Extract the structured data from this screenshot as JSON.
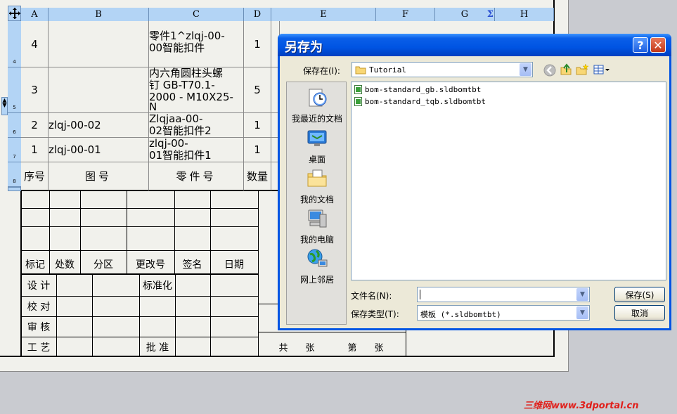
{
  "bom": {
    "columns": [
      "A",
      "B",
      "C",
      "D",
      "E",
      "F",
      "G",
      "H"
    ],
    "rows": [
      {
        "row_no": "4",
        "seq": "4",
        "drawing_no": "",
        "part_name_l1": "零件1^zlqj-00-",
        "part_name_l2": "00智能扣件",
        "qty": "1"
      },
      {
        "row_no": "5",
        "seq": "3",
        "drawing_no": "",
        "part_name_l1": "内六角圆柱头螺",
        "part_name_l2": "钉 GB-T70.1-",
        "part_name_l3": "2000 - M10X25-",
        "part_name_l4": "N",
        "qty": "5"
      },
      {
        "row_no": "6",
        "seq": "2",
        "drawing_no": "zlqj-00-02",
        "part_name_l1": "Zlqjaa-00-",
        "part_name_l2": "02智能扣件2",
        "qty": "1"
      },
      {
        "row_no": "7",
        "seq": "1",
        "drawing_no": "zlqj-00-01",
        "part_name_l1": "zlqj-00-",
        "part_name_l2": "01智能扣件1",
        "qty": "1"
      }
    ],
    "header_row": {
      "row_no": "8",
      "seq": "序号",
      "drawing_no": "图号",
      "part_name": "零件号",
      "qty": "数量"
    }
  },
  "title_block": {
    "revision_labels": [
      "标记",
      "处数",
      "分区",
      "更改号",
      "签名",
      "日期"
    ],
    "design": "设 计",
    "check": "校 对",
    "review": "审 核",
    "process": "工 艺",
    "standardize": "标准化",
    "approve": "批 准",
    "total": "共",
    "sheets": "张",
    "sheet_no": "第",
    "sheets2": "张"
  },
  "dialog": {
    "title": "另存为",
    "help_button": "?",
    "close_button": "✕",
    "save_in_label": "保存在(I):",
    "save_in_value": "Tutorial",
    "places": [
      {
        "label": "我最近的文档",
        "icon": "recent-documents-icon"
      },
      {
        "label": "桌面",
        "icon": "desktop-icon"
      },
      {
        "label": "我的文档",
        "icon": "my-documents-icon"
      },
      {
        "label": "我的电脑",
        "icon": "my-computer-icon"
      },
      {
        "label": "网上邻居",
        "icon": "network-places-icon"
      }
    ],
    "files": [
      "bom-standard_gb.sldbomtbt",
      "bom-standard_tqb.sldbomtbt"
    ],
    "filename_label": "文件名(N):",
    "filename_value": "",
    "filetype_label": "保存类型(T):",
    "filetype_value": "模板 (*.sldbomtbt)",
    "save_button": "保存(S)",
    "cancel_button": "取消"
  },
  "watermark": "三维网www.3dportal.cn"
}
